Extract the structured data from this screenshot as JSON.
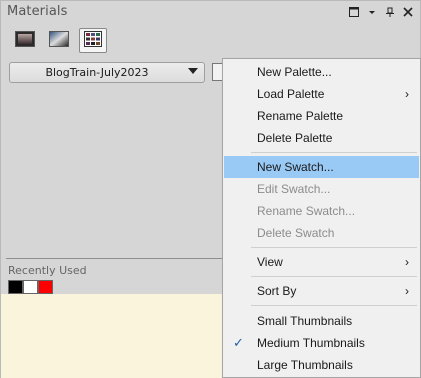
{
  "panel": {
    "title": "Materials",
    "title_icons": [
      "restore-icon",
      "dropdown-arrow-icon",
      "pin-icon",
      "close-icon"
    ]
  },
  "toolbar": {
    "buttons": [
      {
        "name": "gradient-frame-icon"
      },
      {
        "name": "gradient-swatch-icon"
      },
      {
        "name": "grid-swatches-icon",
        "active": true
      }
    ]
  },
  "palette_select": {
    "value": "BlogTrain-July2023"
  },
  "recent": {
    "label": "Recently Used",
    "colors": [
      "#000000",
      "#ffffff",
      "#ff0000"
    ]
  },
  "context_menu": {
    "items": [
      {
        "label": "New Palette..."
      },
      {
        "label": "Load Palette",
        "submenu": true
      },
      {
        "label": "Rename Palette"
      },
      {
        "label": "Delete Palette"
      },
      {
        "label": "New Swatch...",
        "highlighted": true
      },
      {
        "label": "Edit Swatch...",
        "disabled": true
      },
      {
        "label": "Rename Swatch...",
        "disabled": true
      },
      {
        "label": "Delete Swatch",
        "disabled": true
      },
      {
        "label": "View",
        "submenu": true
      },
      {
        "label": "Sort By",
        "submenu": true
      },
      {
        "label": "Small Thumbnails"
      },
      {
        "label": "Medium Thumbnails",
        "checked": true
      },
      {
        "label": "Large Thumbnails"
      }
    ],
    "submenu_arrow": "›",
    "check_mark": "✓"
  },
  "colors": {
    "panel_bg": "#d6d6d6",
    "menu_bg": "#f0f0f0",
    "highlight": "#99c9f5",
    "cream": "#fbf4dc"
  }
}
